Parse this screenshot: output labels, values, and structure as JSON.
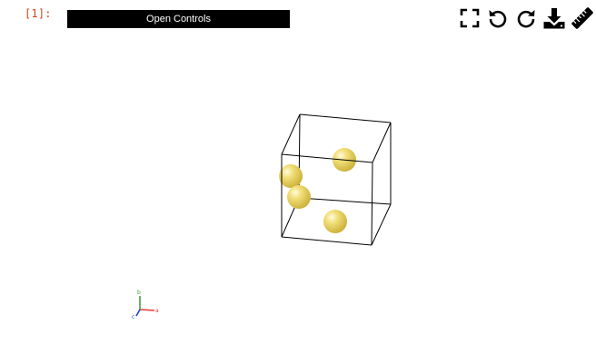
{
  "cell": {
    "prompt": "[1]:"
  },
  "controls": {
    "open_label": "Open Controls"
  },
  "toolbar": {
    "icons": [
      "fullscreen-icon",
      "undo-icon",
      "redo-icon",
      "download-icon",
      "ruler-icon"
    ]
  },
  "scene": {
    "atom_color": "#e8d35a",
    "cell_edge_color": "#000000",
    "atom_count": 4
  },
  "axes": {
    "a_label": "a",
    "b_label": "b",
    "c_label": "c",
    "a_color": "#e53935",
    "b_color": "#43a047",
    "c_color": "#1e3fd6"
  }
}
